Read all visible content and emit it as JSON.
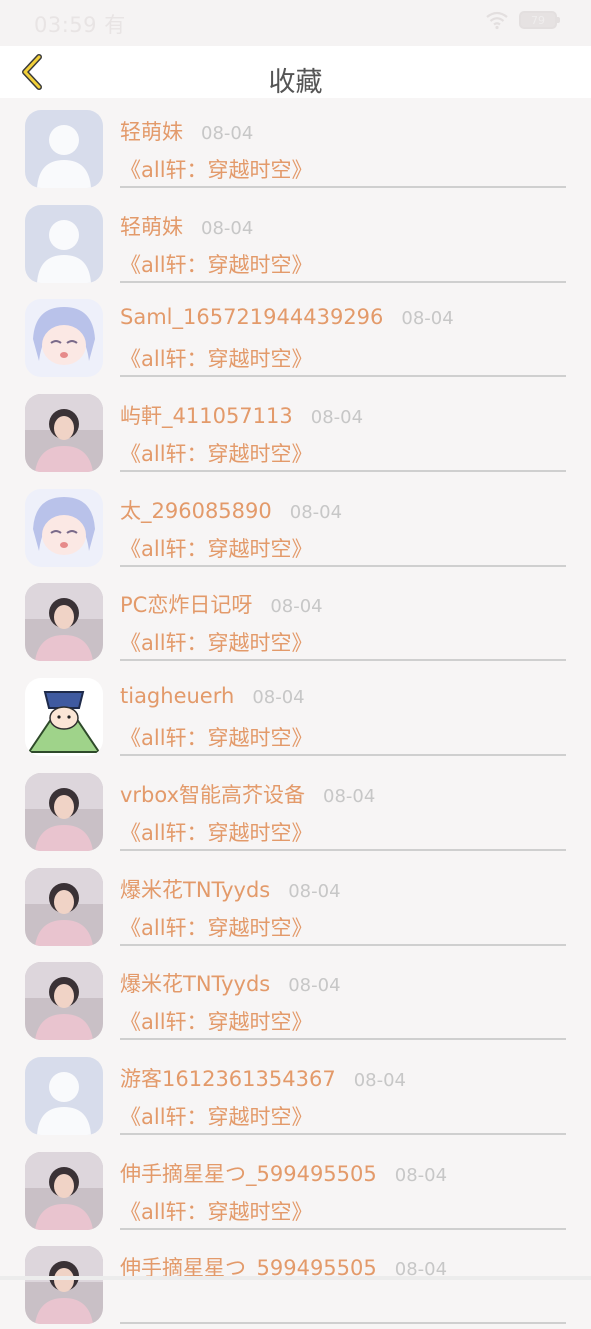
{
  "status_bar": {
    "time": "03:59",
    "time_suffix": "有",
    "battery": "79"
  },
  "header": {
    "title": "收藏"
  },
  "favorites": [
    {
      "user": "轻萌妹",
      "date": "08-04",
      "book": "《all轩：穿越时空》",
      "avatar": "default-avatar"
    },
    {
      "user": "轻萌妹",
      "date": "08-04",
      "book": "《all轩：穿越时空》",
      "avatar": "default-avatar"
    },
    {
      "user": "Saml_165721944439296",
      "date": "08-04",
      "book": "《all轩：穿越时空》",
      "avatar": "anime-avatar"
    },
    {
      "user": "屿軒_411057113",
      "date": "08-04",
      "book": "《all轩：穿越时空》",
      "avatar": "photo-avatar"
    },
    {
      "user": "太_296085890",
      "date": "08-04",
      "book": "《all轩：穿越时空》",
      "avatar": "anime-avatar"
    },
    {
      "user": "PC恋炸日记呀",
      "date": "08-04",
      "book": "《all轩：穿越时空》",
      "avatar": "photo-avatar"
    },
    {
      "user": "tiagheuerh",
      "date": "08-04",
      "book": "《all轩：穿越时空》",
      "avatar": "cartoon-avatar"
    },
    {
      "user": "vrbox智能高芥设备",
      "date": "08-04",
      "book": "《all轩：穿越时空》",
      "avatar": "photo-avatar"
    },
    {
      "user": "爆米花TNTyyds",
      "date": "08-04",
      "book": "《all轩：穿越时空》",
      "avatar": "photo-avatar"
    },
    {
      "user": "爆米花TNTyyds",
      "date": "08-04",
      "book": "《all轩：穿越时空》",
      "avatar": "photo-avatar"
    },
    {
      "user": "游客1612361354367",
      "date": "08-04",
      "book": "《all轩：穿越时空》",
      "avatar": "default-avatar"
    },
    {
      "user": "伸手摘星星つ_599495505",
      "date": "08-04",
      "book": "《all轩：穿越时空》",
      "avatar": "photo-avatar"
    },
    {
      "user": "伸手摘星星つ_599495505",
      "date": "08-04",
      "book": "",
      "avatar": "photo-avatar"
    }
  ]
}
